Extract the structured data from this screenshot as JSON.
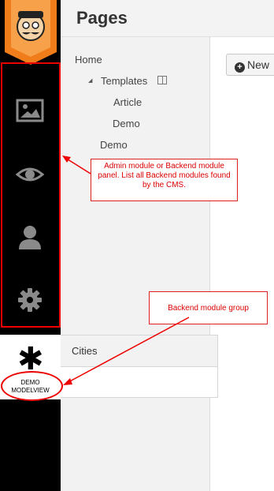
{
  "header": {
    "title": "Pages"
  },
  "toolbar": {
    "new_label": "New"
  },
  "tree": {
    "items": [
      {
        "label": "Home"
      },
      {
        "label": "Templates"
      },
      {
        "label": "Article"
      },
      {
        "label": "Demo"
      },
      {
        "label": "Demo"
      }
    ]
  },
  "rail": {
    "icons": [
      "image-icon",
      "eye-icon",
      "user-icon",
      "gear-icon"
    ],
    "demo_module": {
      "icon": "asterisk-icon",
      "label_line1": "DEMO",
      "label_line2": "MODELVIEW"
    }
  },
  "flyout": {
    "items": [
      {
        "label": "Cities"
      }
    ]
  },
  "annotations": {
    "panel_note": "Admin module or Backend module panel. List all Backend modules found by the CMS.",
    "group_note": "Backend module group"
  },
  "colors": {
    "accent": "#f07d1a",
    "annotation": "#e00000",
    "rail": "#000000",
    "rail_icon": "#8a8a8a"
  }
}
